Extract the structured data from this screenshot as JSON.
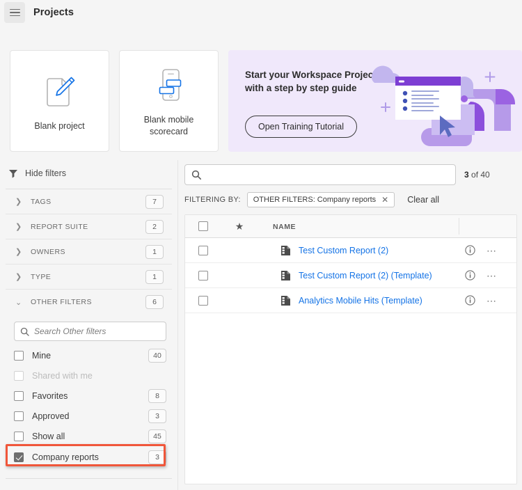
{
  "topbar": {
    "menu_icon": "hamburger-icon",
    "title": "Projects"
  },
  "cards": [
    {
      "id": "blank-project",
      "label": "Blank project",
      "icon": "document-pencil-icon"
    },
    {
      "id": "blank-mobile-scorecard",
      "label": "Blank mobile\nscorecard",
      "label_line1": "Blank mobile",
      "label_line2": "scorecard",
      "icon": "mobile-scorecard-icon"
    }
  ],
  "promo": {
    "headline_line1": "Start your Workspace Project",
    "headline_line2": "with a step by step guide",
    "button_label": "Open Training Tutorial",
    "background_color": "#f0e8fb",
    "art": "workspace-illustration"
  },
  "sidebar": {
    "hide_filters_label": "Hide filters",
    "filter_icon": "funnel-icon",
    "groups": [
      {
        "name": "TAGS",
        "count": "7",
        "expanded": false
      },
      {
        "name": "REPORT SUITE",
        "count": "2",
        "expanded": false
      },
      {
        "name": "OWNERS",
        "count": "1",
        "expanded": false
      },
      {
        "name": "TYPE",
        "count": "1",
        "expanded": false
      },
      {
        "name": "OTHER FILTERS",
        "count": "6",
        "expanded": true
      }
    ],
    "other_filters_search_placeholder": "Search Other filters",
    "other_filters_search_value": "",
    "options": [
      {
        "label": "Mine",
        "count": "40",
        "checked": false,
        "disabled": false
      },
      {
        "label": "Shared with me",
        "count": "",
        "checked": false,
        "disabled": true
      },
      {
        "label": "Favorites",
        "count": "8",
        "checked": false,
        "disabled": false
      },
      {
        "label": "Approved",
        "count": "3",
        "checked": false,
        "disabled": false
      },
      {
        "label": "Show all",
        "count": "45",
        "checked": false,
        "disabled": false
      },
      {
        "label": "Company reports",
        "count": "3",
        "checked": true,
        "disabled": false,
        "highlighted": true
      }
    ],
    "highlight_color": "#f0563a"
  },
  "main": {
    "search_placeholder": "",
    "search_value": "",
    "search_icon": "search-icon",
    "result_count_bold": "3",
    "result_count_rest": " of 40",
    "filtering_by_label": "FILTERING BY:",
    "chips": [
      {
        "label": "OTHER FILTERS: Company reports",
        "remove_icon": "close-icon"
      }
    ],
    "clear_all_label": "Clear all",
    "table": {
      "columns": {
        "select_all": "select-all-checkbox",
        "star": "star-icon",
        "name": "NAME"
      },
      "rows": [
        {
          "name": "Test Custom Report (2)",
          "icon": "project-document-icon",
          "info_icon": "info-icon",
          "more_icon": "more-actions-icon",
          "checked": false
        },
        {
          "name": "Test Custom Report (2) (Template)",
          "icon": "project-document-icon",
          "info_icon": "info-icon",
          "more_icon": "more-actions-icon",
          "checked": false
        },
        {
          "name": "Analytics Mobile Hits (Template)",
          "icon": "project-document-icon",
          "info_icon": "info-icon",
          "more_icon": "more-actions-icon",
          "checked": false
        }
      ]
    },
    "link_color": "#1473e6"
  }
}
